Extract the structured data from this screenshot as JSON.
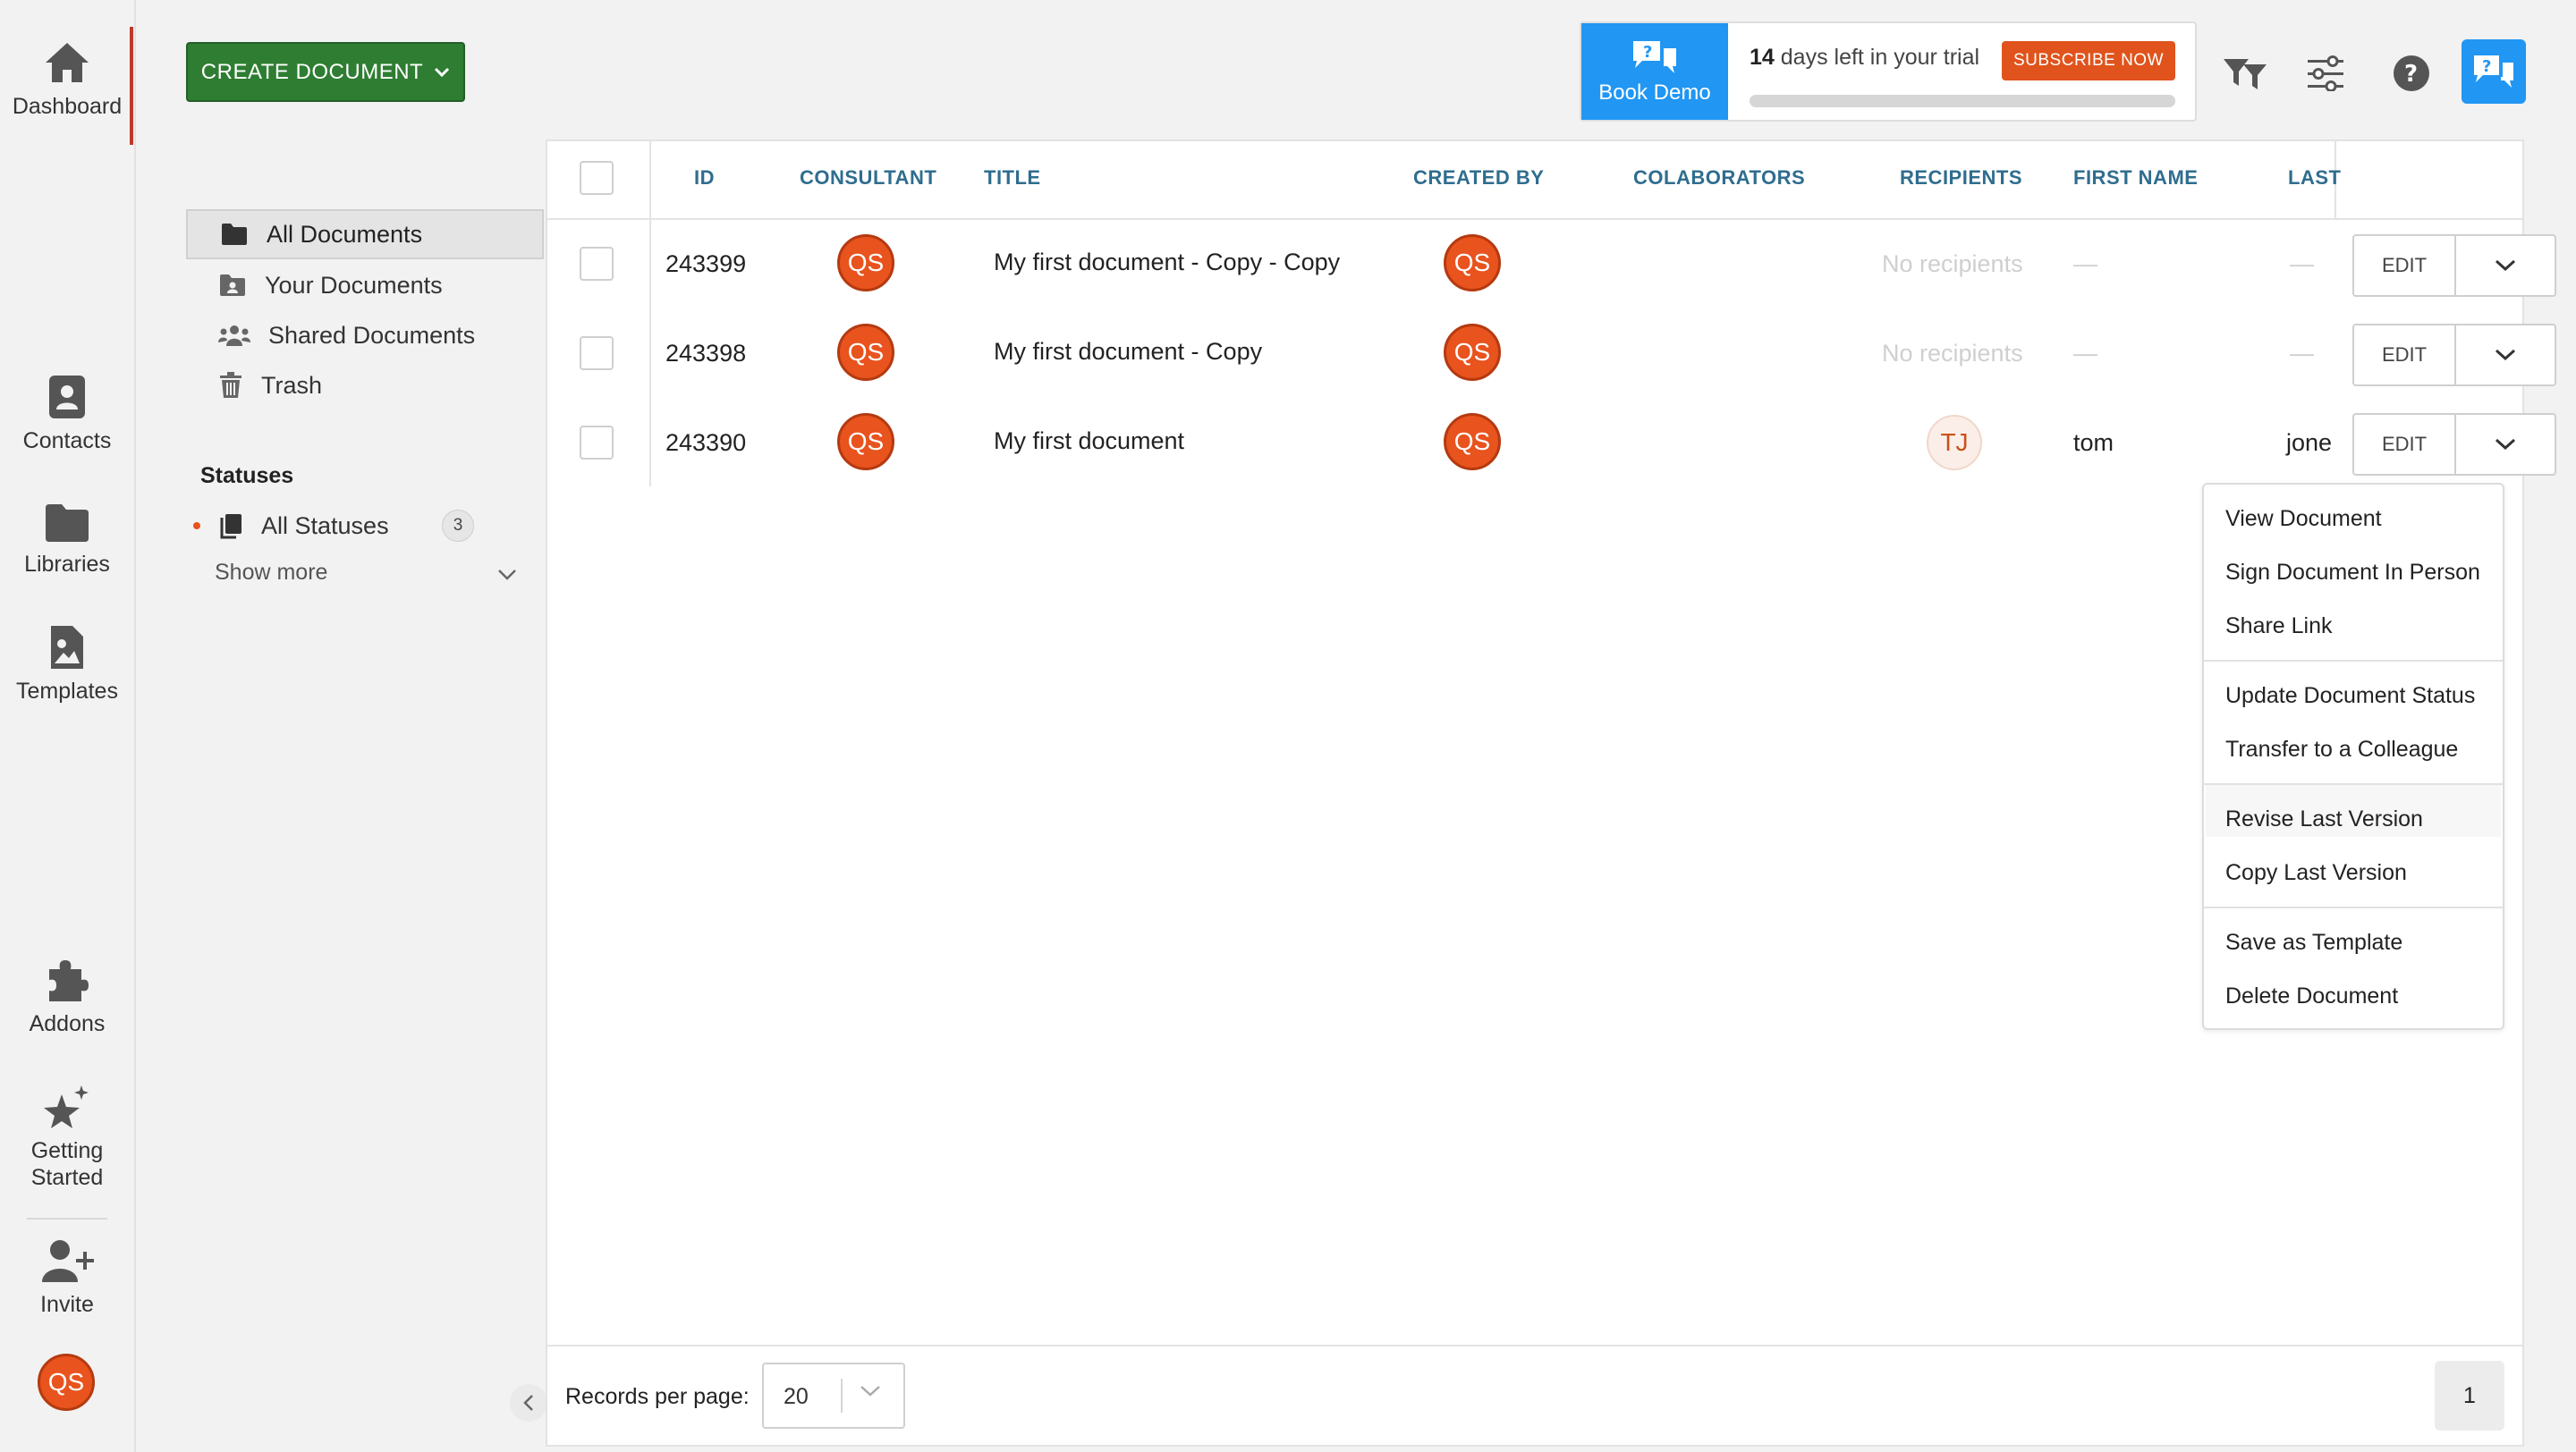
{
  "rail": {
    "dashboard": "Dashboard",
    "contacts": "Contacts",
    "libraries": "Libraries",
    "templates": "Templates",
    "addons": "Addons",
    "getting_started_1": "Getting",
    "getting_started_2": "Started",
    "invite": "Invite",
    "user_initials": "QS"
  },
  "toolbar": {
    "create_label": "CREATE DOCUMENT",
    "book_demo": "Book Demo",
    "trial_days": "14",
    "trial_suffix": " days left in your trial",
    "subscribe": "SUBSCRIBE NOW",
    "trial_progress": 0.0
  },
  "doc_nav": {
    "all": "All Documents",
    "yours": "Your Documents",
    "shared": "Shared Documents",
    "trash": "Trash",
    "statuses_title": "Statuses",
    "all_statuses": "All Statuses",
    "all_statuses_count": "3",
    "show_more": "Show more"
  },
  "table": {
    "columns": {
      "id": "ID",
      "consultant": "CONSULTANT",
      "title": "TITLE",
      "created_by": "CREATED BY",
      "collaborators": "COLABORATORS",
      "recipients": "RECIPIENTS",
      "first_name": "FIRST NAME",
      "last": "LAST"
    },
    "rows": [
      {
        "id": "243399",
        "consultant": "QS",
        "title": "My first document - Copy - Copy",
        "created_by": "QS",
        "recipients": "No recipients",
        "first_name": "—",
        "last": "—",
        "edit": "EDIT"
      },
      {
        "id": "243398",
        "consultant": "QS",
        "title": "My first document - Copy",
        "created_by": "QS",
        "recipients": "No recipients",
        "first_name": "—",
        "last": "—",
        "edit": "EDIT"
      },
      {
        "id": "243390",
        "consultant": "QS",
        "title": "My first document",
        "created_by": "QS",
        "recipients": "TJ",
        "first_name": "tom",
        "last": "jone",
        "edit": "EDIT"
      }
    ]
  },
  "menu": {
    "view": "View Document",
    "sign": "Sign Document In Person",
    "share": "Share Link",
    "update_status": "Update Document Status",
    "transfer": "Transfer to a Colleague",
    "revise": "Revise Last Version",
    "copy": "Copy Last Version",
    "save_template": "Save as Template",
    "delete": "Delete Document"
  },
  "footer": {
    "records_label": "Records per page:",
    "records_value": "20",
    "page": "1"
  },
  "colors": {
    "accent_green": "#2e7d32",
    "brand_blue": "#2196f3",
    "subscribe_orange": "#e0531c",
    "avatar_orange": "#e8531e",
    "header_blue": "#2f6d8f"
  }
}
